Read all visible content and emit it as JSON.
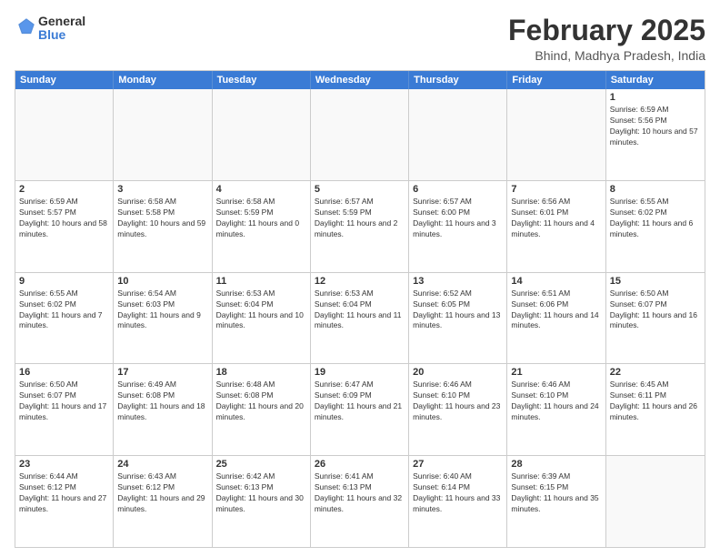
{
  "logo": {
    "general": "General",
    "blue": "Blue"
  },
  "title": "February 2025",
  "location": "Bhind, Madhya Pradesh, India",
  "days_of_week": [
    "Sunday",
    "Monday",
    "Tuesday",
    "Wednesday",
    "Thursday",
    "Friday",
    "Saturday"
  ],
  "weeks": [
    [
      {
        "day": "",
        "info": ""
      },
      {
        "day": "",
        "info": ""
      },
      {
        "day": "",
        "info": ""
      },
      {
        "day": "",
        "info": ""
      },
      {
        "day": "",
        "info": ""
      },
      {
        "day": "",
        "info": ""
      },
      {
        "day": "1",
        "info": "Sunrise: 6:59 AM\nSunset: 5:56 PM\nDaylight: 10 hours and 57 minutes."
      }
    ],
    [
      {
        "day": "2",
        "info": "Sunrise: 6:59 AM\nSunset: 5:57 PM\nDaylight: 10 hours and 58 minutes."
      },
      {
        "day": "3",
        "info": "Sunrise: 6:58 AM\nSunset: 5:58 PM\nDaylight: 10 hours and 59 minutes."
      },
      {
        "day": "4",
        "info": "Sunrise: 6:58 AM\nSunset: 5:59 PM\nDaylight: 11 hours and 0 minutes."
      },
      {
        "day": "5",
        "info": "Sunrise: 6:57 AM\nSunset: 5:59 PM\nDaylight: 11 hours and 2 minutes."
      },
      {
        "day": "6",
        "info": "Sunrise: 6:57 AM\nSunset: 6:00 PM\nDaylight: 11 hours and 3 minutes."
      },
      {
        "day": "7",
        "info": "Sunrise: 6:56 AM\nSunset: 6:01 PM\nDaylight: 11 hours and 4 minutes."
      },
      {
        "day": "8",
        "info": "Sunrise: 6:55 AM\nSunset: 6:02 PM\nDaylight: 11 hours and 6 minutes."
      }
    ],
    [
      {
        "day": "9",
        "info": "Sunrise: 6:55 AM\nSunset: 6:02 PM\nDaylight: 11 hours and 7 minutes."
      },
      {
        "day": "10",
        "info": "Sunrise: 6:54 AM\nSunset: 6:03 PM\nDaylight: 11 hours and 9 minutes."
      },
      {
        "day": "11",
        "info": "Sunrise: 6:53 AM\nSunset: 6:04 PM\nDaylight: 11 hours and 10 minutes."
      },
      {
        "day": "12",
        "info": "Sunrise: 6:53 AM\nSunset: 6:04 PM\nDaylight: 11 hours and 11 minutes."
      },
      {
        "day": "13",
        "info": "Sunrise: 6:52 AM\nSunset: 6:05 PM\nDaylight: 11 hours and 13 minutes."
      },
      {
        "day": "14",
        "info": "Sunrise: 6:51 AM\nSunset: 6:06 PM\nDaylight: 11 hours and 14 minutes."
      },
      {
        "day": "15",
        "info": "Sunrise: 6:50 AM\nSunset: 6:07 PM\nDaylight: 11 hours and 16 minutes."
      }
    ],
    [
      {
        "day": "16",
        "info": "Sunrise: 6:50 AM\nSunset: 6:07 PM\nDaylight: 11 hours and 17 minutes."
      },
      {
        "day": "17",
        "info": "Sunrise: 6:49 AM\nSunset: 6:08 PM\nDaylight: 11 hours and 18 minutes."
      },
      {
        "day": "18",
        "info": "Sunrise: 6:48 AM\nSunset: 6:08 PM\nDaylight: 11 hours and 20 minutes."
      },
      {
        "day": "19",
        "info": "Sunrise: 6:47 AM\nSunset: 6:09 PM\nDaylight: 11 hours and 21 minutes."
      },
      {
        "day": "20",
        "info": "Sunrise: 6:46 AM\nSunset: 6:10 PM\nDaylight: 11 hours and 23 minutes."
      },
      {
        "day": "21",
        "info": "Sunrise: 6:46 AM\nSunset: 6:10 PM\nDaylight: 11 hours and 24 minutes."
      },
      {
        "day": "22",
        "info": "Sunrise: 6:45 AM\nSunset: 6:11 PM\nDaylight: 11 hours and 26 minutes."
      }
    ],
    [
      {
        "day": "23",
        "info": "Sunrise: 6:44 AM\nSunset: 6:12 PM\nDaylight: 11 hours and 27 minutes."
      },
      {
        "day": "24",
        "info": "Sunrise: 6:43 AM\nSunset: 6:12 PM\nDaylight: 11 hours and 29 minutes."
      },
      {
        "day": "25",
        "info": "Sunrise: 6:42 AM\nSunset: 6:13 PM\nDaylight: 11 hours and 30 minutes."
      },
      {
        "day": "26",
        "info": "Sunrise: 6:41 AM\nSunset: 6:13 PM\nDaylight: 11 hours and 32 minutes."
      },
      {
        "day": "27",
        "info": "Sunrise: 6:40 AM\nSunset: 6:14 PM\nDaylight: 11 hours and 33 minutes."
      },
      {
        "day": "28",
        "info": "Sunrise: 6:39 AM\nSunset: 6:15 PM\nDaylight: 11 hours and 35 minutes."
      },
      {
        "day": "",
        "info": ""
      }
    ]
  ]
}
